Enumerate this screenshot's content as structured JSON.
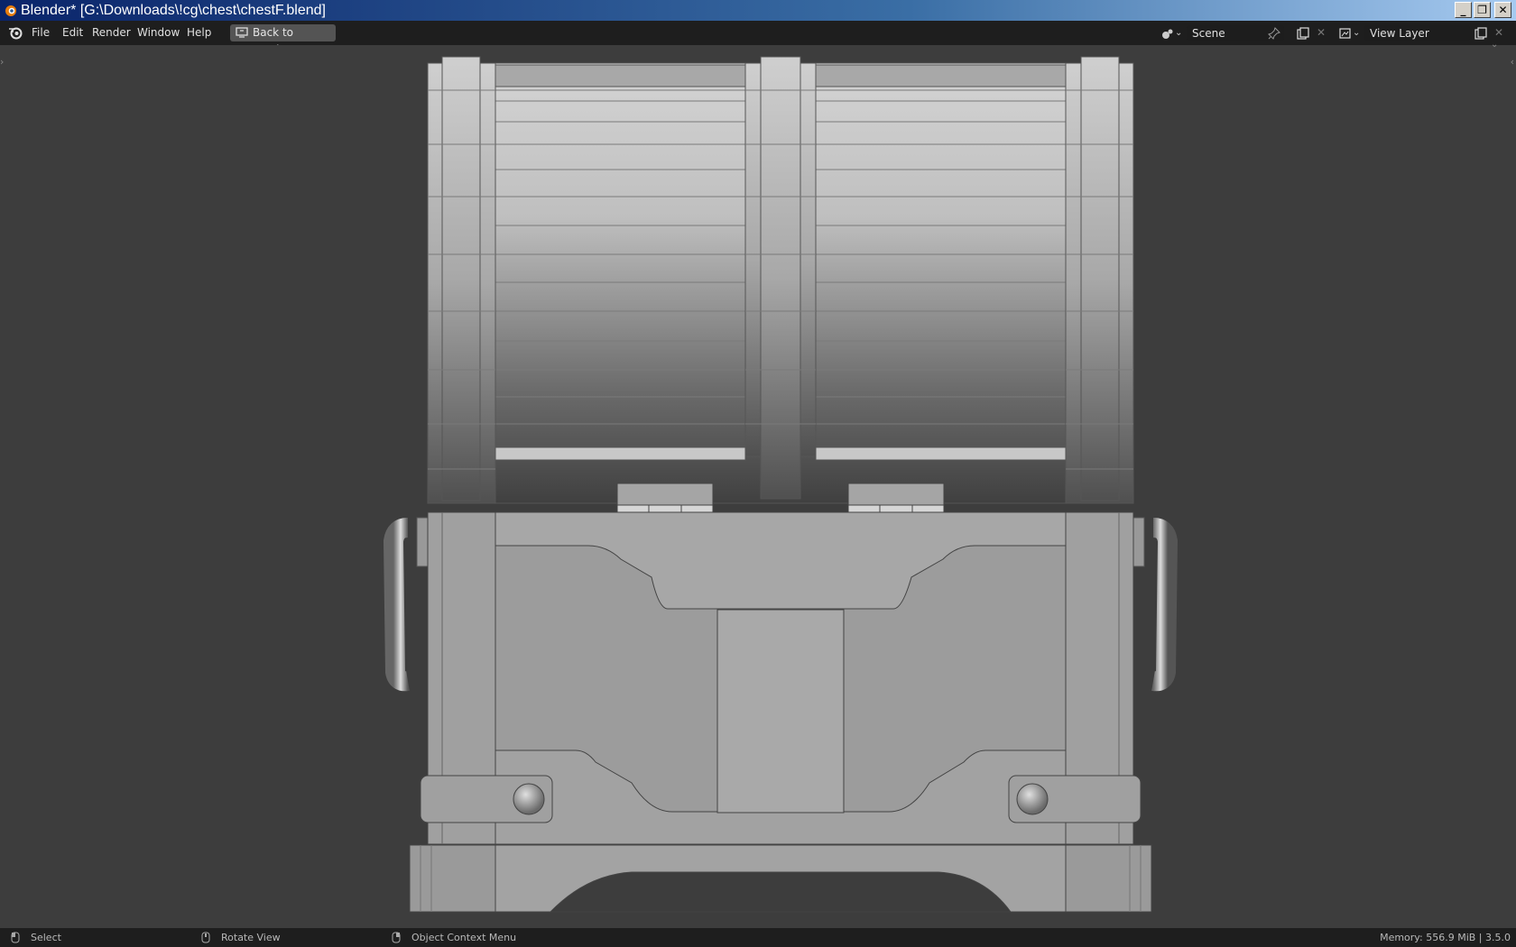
{
  "window": {
    "title": "Blender* [G:\\Downloads\\!cg\\chest\\chestF.blend]",
    "buttons": {
      "minimize": "_",
      "restore": "❐",
      "close": "✕"
    }
  },
  "menubar": {
    "items": [
      "File",
      "Edit",
      "Render",
      "Window",
      "Help"
    ],
    "back_button": "Back to Previous",
    "scene": {
      "value": "Scene"
    },
    "view_layer": {
      "value": "View Layer"
    }
  },
  "statusbar": {
    "select": "Select",
    "rotate": "Rotate View",
    "context_menu": "Object Context Menu",
    "memory": "Memory: 556.9 MiB | 3.5.0"
  },
  "colors": {
    "background": "#3d3d3d",
    "header": "#1e1e1e",
    "model_light": "#c8c8c8",
    "model_dark": "#3e3e3e"
  },
  "icons": [
    "blender-logo-icon",
    "screen-icon",
    "scene-icon",
    "pin-icon",
    "new-icon",
    "close-icon",
    "view-layer-icon",
    "mouse-left-icon",
    "mouse-middle-icon",
    "mouse-right-icon"
  ]
}
